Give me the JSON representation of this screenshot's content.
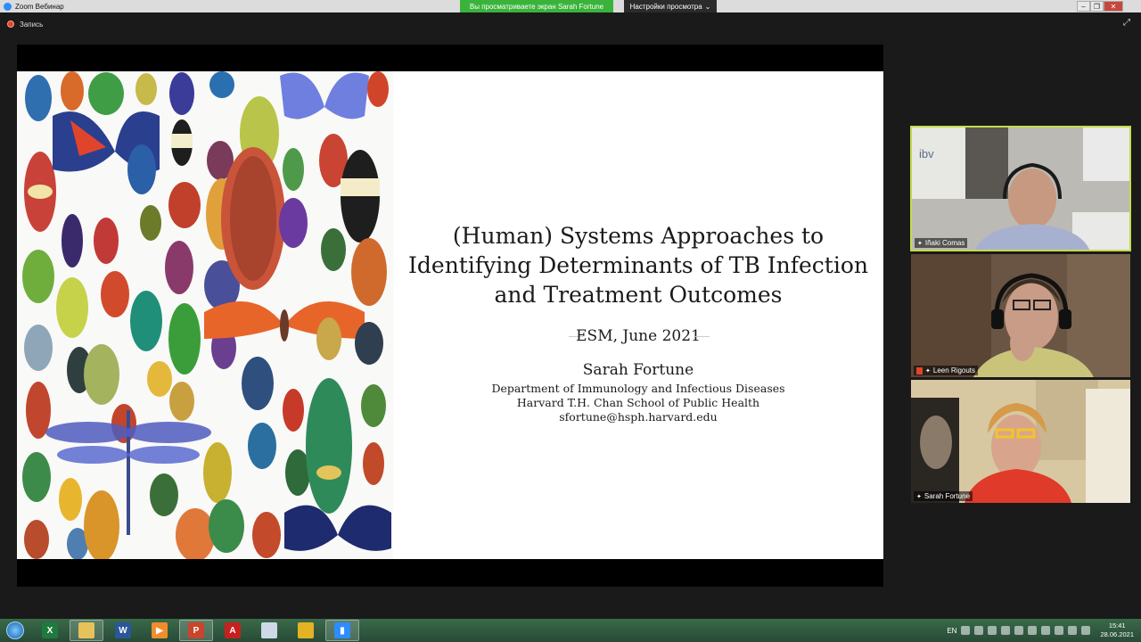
{
  "window": {
    "app_title": "Zoom Вебинар",
    "share_banner": "Вы просматриваете экран Sarah Fortune",
    "view_options": "Настройки просмотра",
    "controls": [
      "–",
      "❐",
      "✕"
    ]
  },
  "recording": {
    "label": "Запись"
  },
  "slide": {
    "title_lines": [
      "(Human) Systems Approaches to",
      "Identifying Determinants of TB Infection",
      "and Treatment Outcomes"
    ],
    "event": "ESM, June 2021",
    "author": "Sarah Fortune",
    "affiliation_lines": [
      "Department of Immunology and Infectious Diseases",
      "Harvard T.H. Chan School of Public Health",
      "sfortune@hsph.harvard.edu"
    ]
  },
  "participants": [
    {
      "name": "Iñaki Comas",
      "active": true,
      "muted": false,
      "wall_sign": "ibv"
    },
    {
      "name": "Leen Rigouts",
      "active": false,
      "muted": true
    },
    {
      "name": "Sarah Fortune",
      "active": false,
      "muted": false
    }
  ],
  "taskbar": {
    "apps": [
      {
        "icon": "excel-icon",
        "glyph": "X",
        "color": "#1f7a3d",
        "open": false
      },
      {
        "icon": "folder-icon",
        "glyph": "",
        "color": "#e7c25a",
        "open": true
      },
      {
        "icon": "word-icon",
        "glyph": "W",
        "color": "#2b579a",
        "open": false
      },
      {
        "icon": "media-player-icon",
        "glyph": "▶",
        "color": "#f08c2a",
        "open": false
      },
      {
        "icon": "powerpoint-icon",
        "glyph": "P",
        "color": "#c9452b",
        "open": true
      },
      {
        "icon": "pdf-icon",
        "glyph": "A",
        "color": "#c8201e",
        "open": false
      },
      {
        "icon": "notepad-icon",
        "glyph": "",
        "color": "#cfd8e6",
        "open": false
      },
      {
        "icon": "chrome-icon",
        "glyph": "",
        "color": "#e3b323",
        "open": false
      },
      {
        "icon": "zoom-icon",
        "glyph": "▮",
        "color": "#2d8cff",
        "open": true
      }
    ],
    "language": "EN",
    "time": "15:41",
    "date": "28.06.2021"
  },
  "colors": {
    "active_speaker_border": "#c7d94b",
    "share_banner": "#3ab33a",
    "recording": "#e0452b"
  }
}
